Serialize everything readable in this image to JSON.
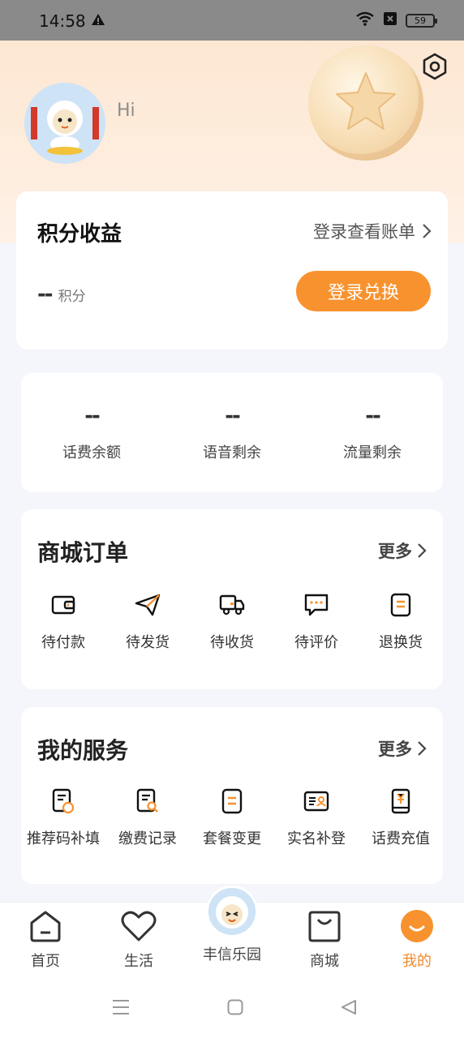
{
  "status": {
    "time": "14:58",
    "battery": "59"
  },
  "header": {
    "greeting": "Hi"
  },
  "points": {
    "title": "积分收益",
    "link": "登录查看账单",
    "value": "--",
    "unit": "积分",
    "button": "登录兑换"
  },
  "balances": [
    {
      "value": "--",
      "label": "话费余额"
    },
    {
      "value": "--",
      "label": "语音剩余"
    },
    {
      "value": "--",
      "label": "流量剩余"
    }
  ],
  "orders": {
    "title": "商城订单",
    "more": "更多",
    "items": [
      {
        "label": "待付款",
        "icon": "wallet-icon"
      },
      {
        "label": "待发货",
        "icon": "send-icon"
      },
      {
        "label": "待收货",
        "icon": "truck-icon"
      },
      {
        "label": "待评价",
        "icon": "comment-icon"
      },
      {
        "label": "退换货",
        "icon": "return-icon"
      }
    ]
  },
  "services": {
    "title": "我的服务",
    "more": "更多",
    "items": [
      {
        "label": "推荐码补填",
        "icon": "referral-doc-icon"
      },
      {
        "label": "缴费记录",
        "icon": "payment-record-icon"
      },
      {
        "label": "套餐变更",
        "icon": "plan-change-icon"
      },
      {
        "label": "实名补登",
        "icon": "id-card-icon"
      },
      {
        "label": "话费充值",
        "icon": "phone-recharge-icon"
      }
    ]
  },
  "tabs": [
    {
      "label": "首页",
      "icon": "home-icon"
    },
    {
      "label": "生活",
      "icon": "heart-icon"
    },
    {
      "label": "丰信乐园",
      "icon": "mascot-avatar"
    },
    {
      "label": "商城",
      "icon": "shopping-bag-icon"
    },
    {
      "label": "我的",
      "icon": "profile-smile-icon"
    }
  ],
  "colors": {
    "accent": "#f8922e",
    "hero_bg": "#fde7d2",
    "active_tab": "#f08a2c"
  }
}
